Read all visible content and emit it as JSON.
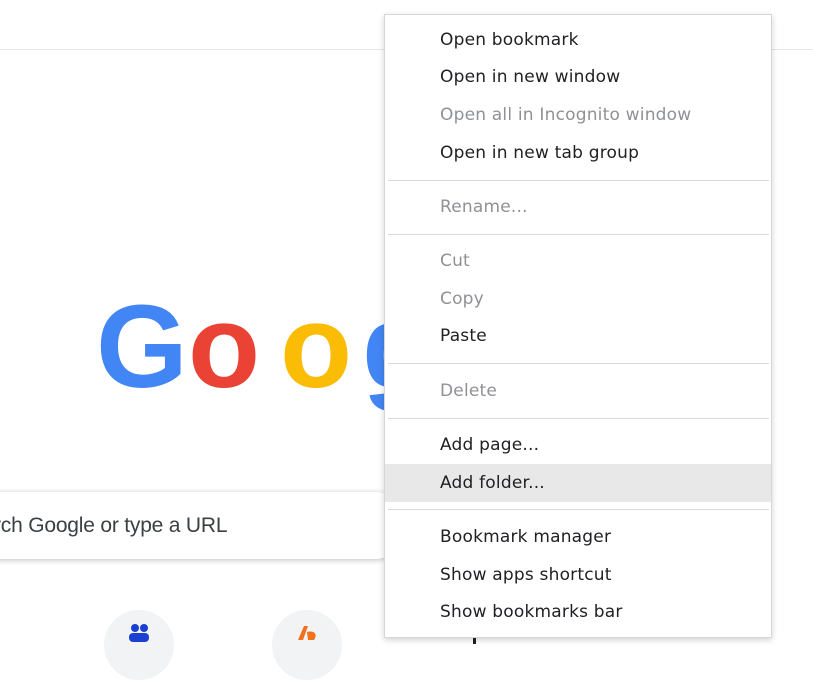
{
  "logo": {
    "letters": [
      {
        "char": "G",
        "color": "#4285F4"
      },
      {
        "char": "o",
        "color": "#EA4335"
      },
      {
        "char": "o",
        "color": "#FBBC05"
      },
      {
        "char": "g",
        "color": "#4285F4"
      }
    ]
  },
  "search": {
    "placeholder": "rch Google or type a URL"
  },
  "shortcuts": [
    {
      "icon": "people-icon",
      "color": "#1a3fd1"
    },
    {
      "icon": "brand-icon",
      "color": "#f2711c"
    }
  ],
  "menu": {
    "open_bookmark": "Open bookmark",
    "open_new_window": "Open in new window",
    "open_all_incognito": "Open all in Incognito window",
    "open_new_tab_group": "Open in new tab group",
    "rename": "Rename...",
    "cut": "Cut",
    "copy": "Copy",
    "paste": "Paste",
    "delete": "Delete",
    "add_page": "Add page...",
    "add_folder": "Add folder...",
    "bookmark_manager": "Bookmark manager",
    "show_apps_shortcut": "Show apps shortcut",
    "show_bookmarks_bar": "Show bookmarks bar"
  },
  "colors": {
    "disabled_text": "#8f9194",
    "hover_bg": "#e8e8e8"
  }
}
